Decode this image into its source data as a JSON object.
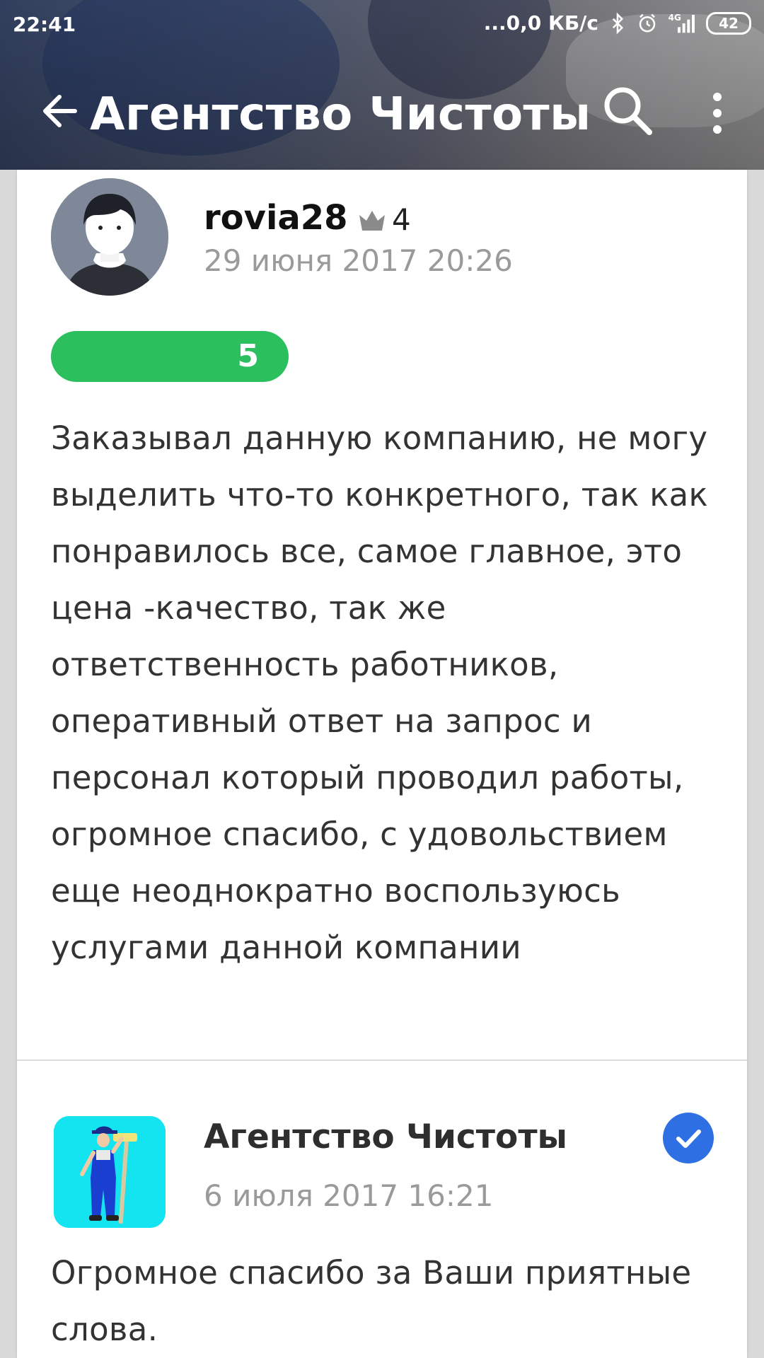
{
  "status_bar": {
    "time": "22:41",
    "network_speed": "...0,0 КБ/с",
    "network_type": "4G",
    "battery": "42"
  },
  "app_bar": {
    "title": "Агентство Чистоты",
    "icons": [
      "back-arrow-icon",
      "search-icon",
      "more-vertical-icon"
    ]
  },
  "review": {
    "author": "rovia28",
    "author_rank": "4",
    "date": "29 июня 2017 20:26",
    "rating": "5",
    "text": "Заказывал данную компанию, не могу выделить что-то конкретного, так как понравилось все, самое главное, это цена -качество, так же ответственность работников, оперативный ответ на запрос и персонал который проводил работы, огромное спасибо, с удовольствием еще неоднократно воспользуюсь услугами данной компании"
  },
  "reply": {
    "author": "Агентство Чистоты",
    "date": "6 июля 2017 16:21",
    "text": "Огромное спасибо за Ваши приятные слова."
  },
  "colors": {
    "rating_pill": "#2bbf5e",
    "verified_badge": "#2f6fe4",
    "logo_background": "#14e4f0",
    "muted_text": "#9a9a9a"
  }
}
